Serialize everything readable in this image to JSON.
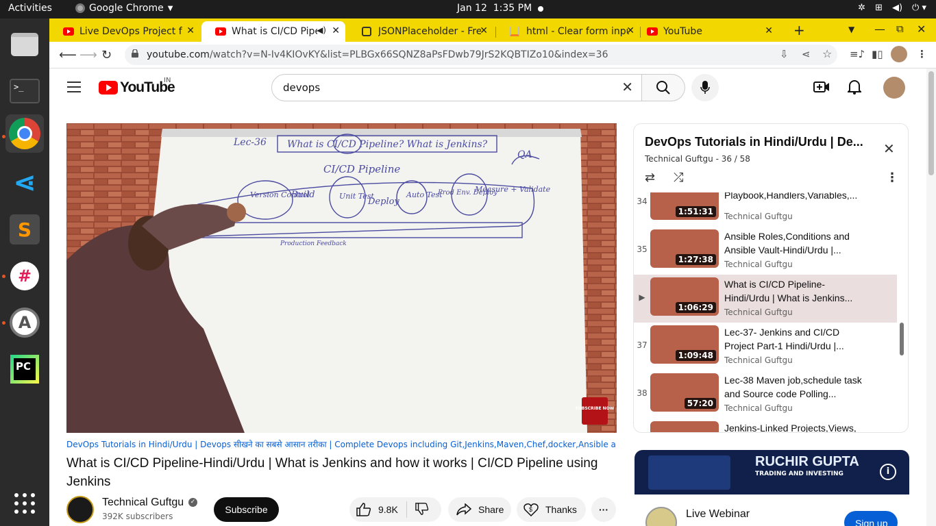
{
  "system_bar": {
    "activities": "Activities",
    "app": "Google Chrome",
    "date": "Jan 12",
    "time": "1:35 PM"
  },
  "browser": {
    "tabs": [
      {
        "title": "Live DevOps Project f",
        "favicon": "youtube-icon"
      },
      {
        "title": "What is CI/CD Pipe",
        "favicon": "youtube-icon",
        "active": true,
        "audio": true
      },
      {
        "title": "JSONPlaceholder - Fre",
        "favicon": "jsonplaceholder-icon"
      },
      {
        "title": "html - Clear form inpu",
        "favicon": "stackoverflow-icon"
      },
      {
        "title": "YouTube",
        "favicon": "youtube-icon"
      }
    ],
    "url_host": "youtube.com",
    "url_rest": "/watch?v=N-Iv4KIOvKY&list=PLBGx66SQNZ8aPsFDwb79JrS2KQBTIZo10&index=36"
  },
  "youtube": {
    "logo": "YouTube",
    "country": "IN",
    "search_value": "devops",
    "playlist_link": "DevOps Tutorials in Hindi/Urdu | Devops सीखने का सबसे आसान तरीका | Complete Devops including Git,Jenkins,Maven,Chef,docker,Ansible and Kubernetes",
    "video_title": "What is CI/CD Pipeline-Hindi/Urdu | What is Jenkins and how it works | CI/CD Pipeline using Jenkins",
    "channel": {
      "name": "Technical Guftgu",
      "subscribers": "392K subscribers",
      "verified": true
    },
    "buttons": {
      "subscribe": "Subscribe",
      "likes": "9.8K",
      "share": "Share",
      "thanks": "Thanks"
    },
    "whiteboard": {
      "lec": "Lec-36",
      "heading": "What is CI/CD Pipeline? What is Jenkins?",
      "pipeline_title": "CI/CD Pipeline",
      "qa": "QA",
      "stages": [
        "Version Control",
        "Build",
        "Unit Test",
        "Deploy",
        "Auto Test",
        "Prod Env. Deploy",
        "Measure + Validate"
      ],
      "feedback": "Production Feedback",
      "sticker": "SUBSCRIBE NOW"
    },
    "playlist": {
      "title": "DevOps Tutorials in Hindi/Urdu | De...",
      "meta": "Technical Guftgu - 36 / 58",
      "items": [
        {
          "index": "34",
          "title": "Playbook,Handlers,Variables,...",
          "channel": "Technical Guftgu",
          "duration": "1:51:31"
        },
        {
          "index": "35",
          "title": "Ansible Roles,Conditions and Ansible Vault-Hindi/Urdu |...",
          "channel": "Technical Guftgu",
          "duration": "1:27:38"
        },
        {
          "index": "▶",
          "title": "What is CI/CD Pipeline-Hindi/Urdu | What is Jenkins...",
          "channel": "Technical Guftgu",
          "duration": "1:06:29"
        },
        {
          "index": "37",
          "title": "Lec-37- Jenkins and CI/CD Project Part-1 Hindi/Urdu |...",
          "channel": "Technical Guftgu",
          "duration": "1:09:48"
        },
        {
          "index": "38",
          "title": "Lec-38 Maven job,schedule task and Source code Polling...",
          "channel": "Technical Guftgu",
          "duration": "57:20"
        },
        {
          "index": "",
          "title": "Jenkins-Linked Projects,Views,",
          "channel": "",
          "duration": ""
        }
      ]
    },
    "ad": {
      "banner_brand": "RUCHIR GUPTA",
      "banner_tag": "TRADING AND INVESTING",
      "name": "Live Webinar",
      "cta": "Sign up"
    }
  },
  "colors": {
    "accent": "#ff0000",
    "tabstrip": "#f2d800",
    "link": "#065fd4"
  }
}
